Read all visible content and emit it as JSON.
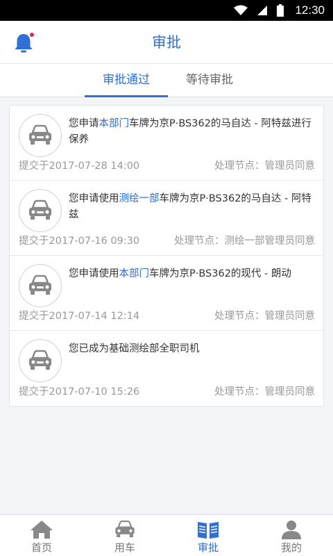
{
  "status_bar": {
    "time": "12:30"
  },
  "header": {
    "title": "审批"
  },
  "tabs": [
    {
      "label": "审批通过",
      "active": true
    },
    {
      "label": "等待审批",
      "active": false
    }
  ],
  "items": [
    {
      "msg_pre": "您申请",
      "msg_hl": "本部门",
      "msg_post": "车牌为京P·BS362的马自达 - 阿特兹进行保养",
      "submitted": "提交于2017-07-28 14:00",
      "node": "处理节点：管理员同意"
    },
    {
      "msg_pre": "您申请使用",
      "msg_hl": "测绘一部",
      "msg_post": "车牌为京P·BS362的马自达 - 阿特兹",
      "submitted": "提交于2017-07-16 09:30",
      "node": "处理节点：测绘一部管理员同意"
    },
    {
      "msg_pre": "您申请使用",
      "msg_hl": "本部门",
      "msg_post": "车牌为京P·BS362的现代 - 朗动",
      "submitted": "提交于2017-07-14 12:14",
      "node": "处理节点：管理员同意"
    },
    {
      "msg_pre": "您已成为基础测绘部全职司机",
      "msg_hl": "",
      "msg_post": "",
      "submitted": "提交于2017-07-10 15:26",
      "node": "处理节点：管理员同意"
    }
  ],
  "nav": [
    {
      "label": "首页",
      "icon": "home-icon",
      "active": false
    },
    {
      "label": "用车",
      "icon": "car-icon",
      "active": false
    },
    {
      "label": "审批",
      "icon": "approval-book-icon",
      "active": true
    },
    {
      "label": "我的",
      "icon": "profile-icon",
      "active": false
    }
  ],
  "colors": {
    "accent": "#2f6fd8",
    "notification_dot": "#e0245e",
    "muted": "#999999"
  }
}
